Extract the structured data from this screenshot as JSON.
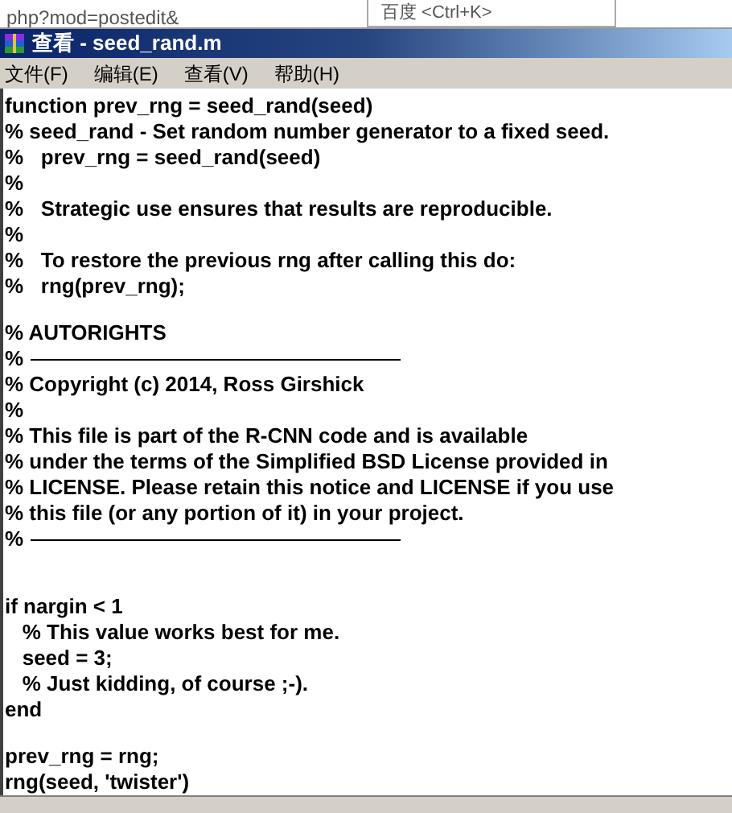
{
  "browser_strip": {
    "address": "php?mod=postedit&",
    "search": "百度 <Ctrl+K>"
  },
  "window": {
    "title": "查看 - seed_rand.m"
  },
  "menu": [
    "文件(F)",
    "编辑(E)",
    "查看(V)",
    "帮助(H)"
  ],
  "lines": [
    {
      "kind": "text",
      "text": "function prev_rng = seed_rand(seed)"
    },
    {
      "kind": "text",
      "text": "% seed_rand - Set random number generator to a fixed seed."
    },
    {
      "kind": "text",
      "text": "%   prev_rng = seed_rand(seed)"
    },
    {
      "kind": "text",
      "text": "%"
    },
    {
      "kind": "text",
      "text": "%   Strategic use ensures that results are reproducible."
    },
    {
      "kind": "text",
      "text": "%"
    },
    {
      "kind": "text",
      "text": "%   To restore the previous rng after calling this do:"
    },
    {
      "kind": "text",
      "text": "%   rng(prev_rng);"
    },
    {
      "kind": "blank"
    },
    {
      "kind": "text",
      "text": "% AUTORIGHTS"
    },
    {
      "kind": "rule",
      "text": "%"
    },
    {
      "kind": "text",
      "text": "% Copyright (c) 2014, Ross Girshick"
    },
    {
      "kind": "text",
      "text": "%"
    },
    {
      "kind": "text",
      "text": "% This file is part of the R-CNN code and is available"
    },
    {
      "kind": "text",
      "text": "% under the terms of the Simplified BSD License provided in"
    },
    {
      "kind": "text",
      "text": "% LICENSE. Please retain this notice and LICENSE if you use"
    },
    {
      "kind": "text",
      "text": "% this file (or any portion of it) in your project."
    },
    {
      "kind": "rule",
      "text": "%"
    },
    {
      "kind": "blank"
    },
    {
      "kind": "blank"
    },
    {
      "kind": "text",
      "text": "if nargin < 1"
    },
    {
      "kind": "text",
      "text": "   % This value works best for me."
    },
    {
      "kind": "text",
      "text": "   seed = 3;"
    },
    {
      "kind": "text",
      "text": "   % Just kidding, of course ;-)."
    },
    {
      "kind": "text",
      "text": "end"
    },
    {
      "kind": "blank"
    },
    {
      "kind": "text",
      "text": "prev_rng = rng;"
    },
    {
      "kind": "text",
      "text": "rng(seed, 'twister')"
    }
  ]
}
